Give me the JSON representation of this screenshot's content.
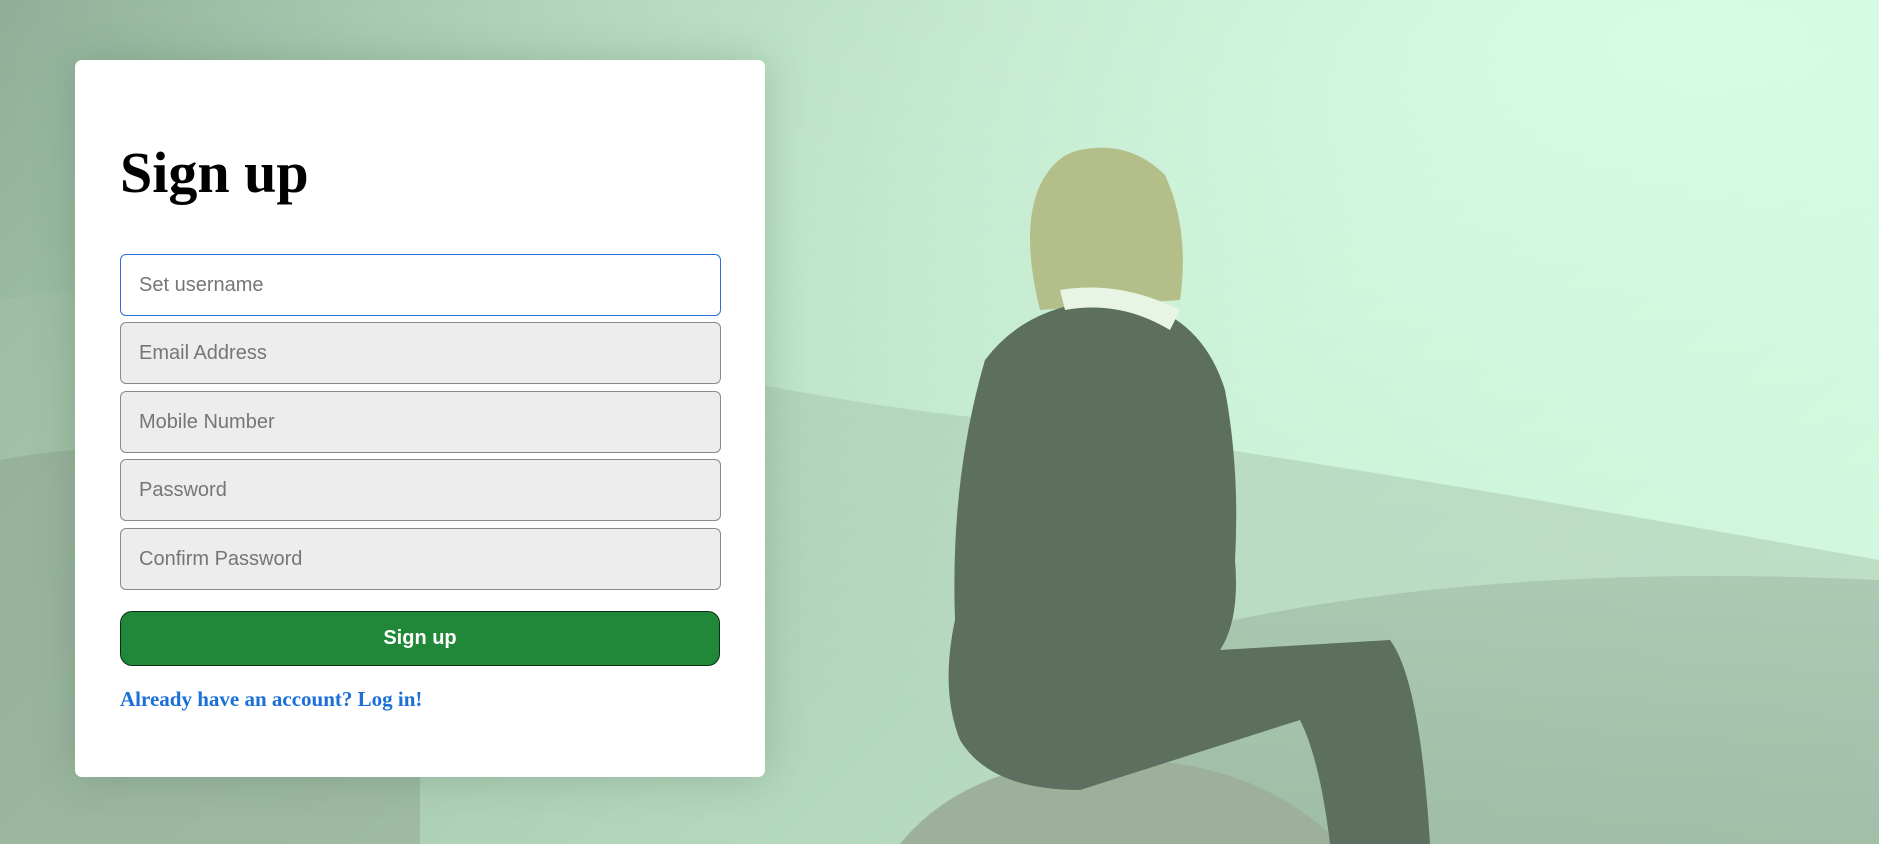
{
  "form": {
    "title": "Sign up",
    "username_placeholder": "Set username",
    "email_placeholder": "Email Address",
    "mobile_placeholder": "Mobile Number",
    "password_placeholder": "Password",
    "confirm_password_placeholder": "Confirm Password",
    "submit_label": "Sign up",
    "login_link": "Already have an account? Log in!"
  },
  "colors": {
    "button": "#21883a",
    "link": "#1a6fd8",
    "focus_border": "#2a6fdb",
    "background_tint": "#c3ecd0"
  }
}
